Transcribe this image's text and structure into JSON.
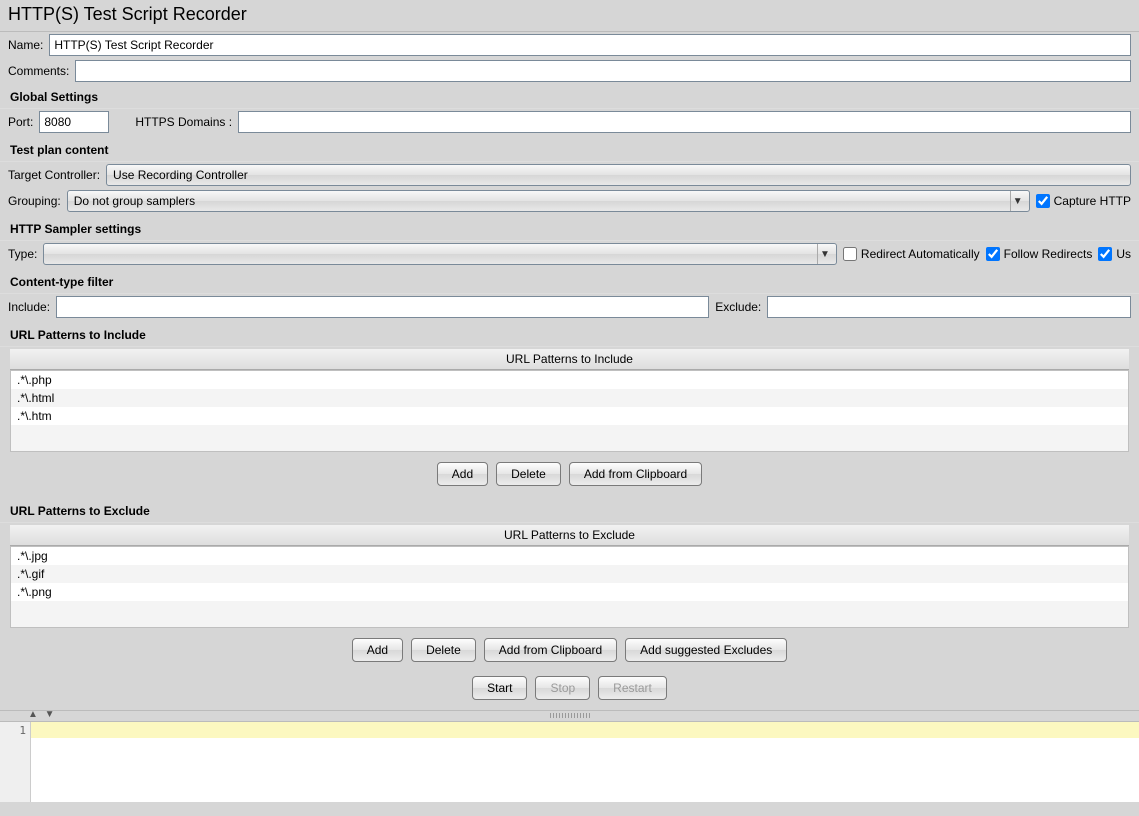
{
  "title": "HTTP(S) Test Script Recorder",
  "name_label": "Name:",
  "name_value": "HTTP(S) Test Script Recorder",
  "comments_label": "Comments:",
  "comments_value": "",
  "global": {
    "heading": "Global Settings",
    "port_label": "Port:",
    "port_value": "8080",
    "domains_label": "HTTPS Domains :",
    "domains_value": ""
  },
  "plan": {
    "heading": "Test plan content",
    "target_label": "Target Controller:",
    "target_value": "Use Recording Controller",
    "grouping_label": "Grouping:",
    "grouping_value": "Do not group samplers",
    "capture_label": "Capture HTTP"
  },
  "sampler": {
    "heading": "HTTP Sampler settings",
    "type_label": "Type:",
    "type_value": "",
    "redirect_auto": "Redirect Automatically",
    "follow_redirects": "Follow Redirects",
    "use_keepalive": "Us"
  },
  "ctfilter": {
    "heading": "Content-type filter",
    "include_label": "Include:",
    "include_value": "",
    "exclude_label": "Exclude:",
    "exclude_value": ""
  },
  "pat_include": {
    "heading": "URL Patterns to Include",
    "table_header": "URL Patterns to Include",
    "rows": [
      ".*\\.php",
      ".*\\.html",
      ".*\\.htm"
    ],
    "btn_add": "Add",
    "btn_delete": "Delete",
    "btn_clip": "Add from Clipboard"
  },
  "pat_exclude": {
    "heading": "URL Patterns to Exclude",
    "table_header": "URL Patterns to Exclude",
    "rows": [
      ".*\\.jpg",
      ".*\\.gif",
      ".*\\.png"
    ],
    "btn_add": "Add",
    "btn_delete": "Delete",
    "btn_clip": "Add from Clipboard",
    "btn_suggest": "Add suggested Excludes"
  },
  "control": {
    "start": "Start",
    "stop": "Stop",
    "restart": "Restart"
  },
  "log": {
    "line_number": "1"
  },
  "checks": {
    "capture_http": true,
    "redirect_auto": false,
    "follow_redirects": true,
    "use_keepalive": true
  }
}
